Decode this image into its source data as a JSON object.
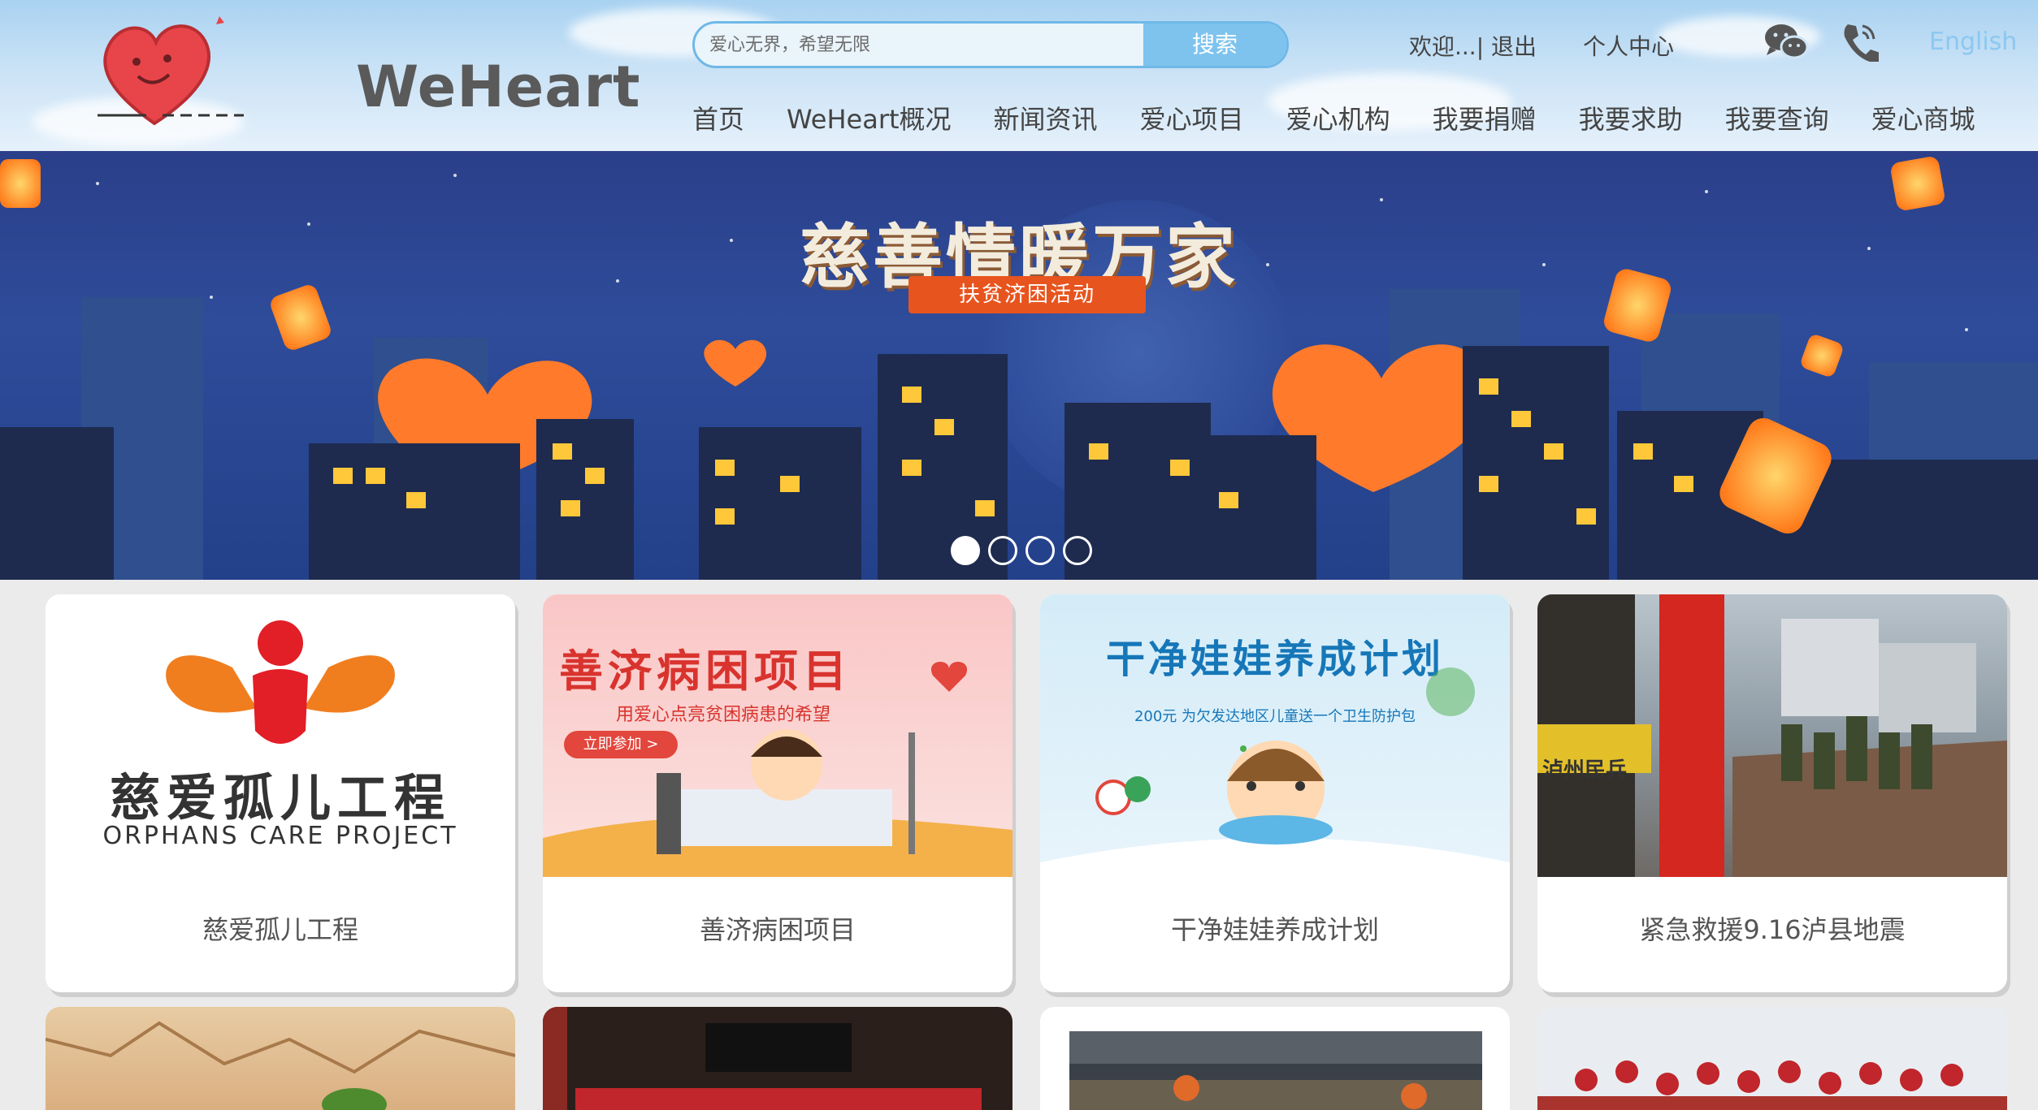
{
  "logo": {
    "text": "WeHeart"
  },
  "search": {
    "placeholder": "爱心无界，希望无限",
    "button_label": "搜索"
  },
  "top_links": {
    "welcome": "欢迎...| 退出",
    "personal_center": "个人中心",
    "english": "English"
  },
  "icons": {
    "wechat": "wechat-icon",
    "phone": "phone-icon"
  },
  "nav": {
    "items": [
      {
        "label": "首页"
      },
      {
        "label": "WeHeart概况"
      },
      {
        "label": "新闻资讯"
      },
      {
        "label": "爱心项目"
      },
      {
        "label": "爱心机构"
      },
      {
        "label": "我要捐赠"
      },
      {
        "label": "我要求助"
      },
      {
        "label": "我要查询"
      },
      {
        "label": "爱心商城"
      }
    ]
  },
  "banner": {
    "title": "慈善情暖万家",
    "subtitle": "扶贫济困活动",
    "slide_count": 4,
    "active_slide": 1
  },
  "cards": [
    {
      "caption": "慈爱孤儿工程",
      "image_title": "慈爱孤儿工程",
      "image_subtitle": "ORPHANS CARE PROJECT"
    },
    {
      "caption": "善济病困项目",
      "image_title": "善济病困项目",
      "image_subtitle": "用爱心点亮贫困病患的希望",
      "image_button": "立即参加 >"
    },
    {
      "caption": "干净娃娃养成计划",
      "image_title": "干净娃娃养成计划",
      "image_subtitle": "200元 为欠发达地区儿童送一个卫生防护包"
    },
    {
      "caption": "紧急救援9.16泸县地震",
      "image_title": "",
      "image_subtitle": "泸州民兵"
    }
  ],
  "colors": {
    "accent": "#7ec3ee",
    "heart": "#e8454a",
    "banner_bg": "#2b3f8a",
    "orange": "#e8541e"
  }
}
